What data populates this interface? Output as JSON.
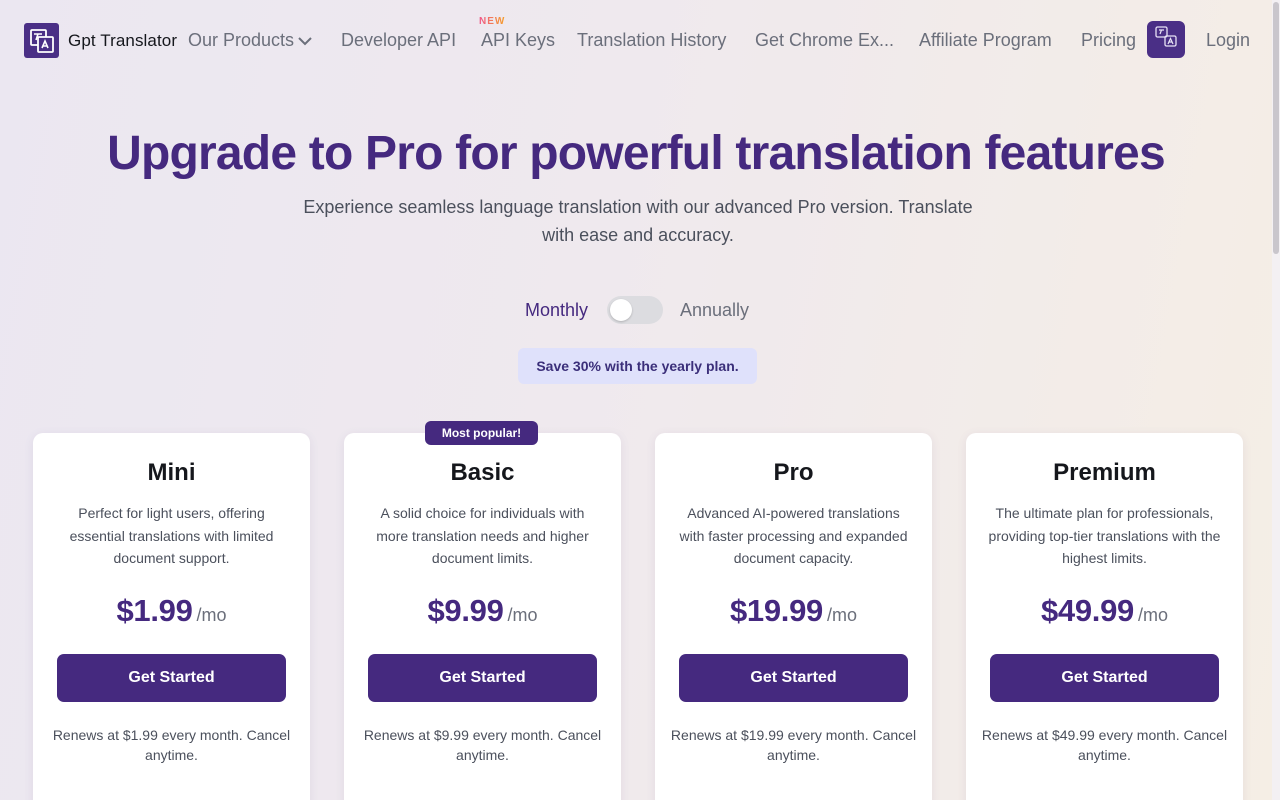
{
  "header": {
    "logo_text": "Gpt Translator",
    "nav": [
      {
        "label": "Our Products"
      },
      {
        "label": "Developer API"
      },
      {
        "label": "API Keys",
        "badge": "NEW"
      },
      {
        "label": "Translation History"
      },
      {
        "label": "Get Chrome Ex..."
      },
      {
        "label": "Affiliate Program"
      },
      {
        "label": "Pricing"
      }
    ],
    "login_label": "Login"
  },
  "hero": {
    "title": "Upgrade to Pro for powerful translation features",
    "subtitle": "Experience seamless language translation with our advanced Pro version. Translate with ease and accuracy."
  },
  "billing": {
    "monthly_label": "Monthly",
    "annually_label": "Annually",
    "save_text": "Save 30% with the yearly plan."
  },
  "plans": [
    {
      "name": "Mini",
      "description": "Perfect for light users, offering essential translations with limited document support.",
      "price": "$1.99",
      "period": "/mo",
      "button": "Get Started",
      "renew": "Renews at $1.99 every month. Cancel anytime."
    },
    {
      "name": "Basic",
      "badge": "Most popular!",
      "description": "A solid choice for individuals with more translation needs and higher document limits.",
      "price": "$9.99",
      "period": "/mo",
      "button": "Get Started",
      "renew": "Renews at $9.99 every month. Cancel anytime."
    },
    {
      "name": "Pro",
      "description": "Advanced AI-powered translations with faster processing and expanded document capacity.",
      "price": "$19.99",
      "period": "/mo",
      "button": "Get Started",
      "renew": "Renews at $19.99 every month. Cancel anytime."
    },
    {
      "name": "Premium",
      "description": "The ultimate plan for professionals, providing top-tier translations with the highest limits.",
      "price": "$49.99",
      "period": "/mo",
      "button": "Get Started",
      "renew": "Renews at $49.99 every month. Cancel anytime."
    }
  ],
  "colors": {
    "brand": "#45297f",
    "save_pill_bg": "#dfe1fb",
    "new_badge": "#f05a2c"
  },
  "icons": {
    "logo": "translate-logo-icon",
    "products_chevron": "chevron-down-icon",
    "language_button": "language-switch-icon"
  }
}
